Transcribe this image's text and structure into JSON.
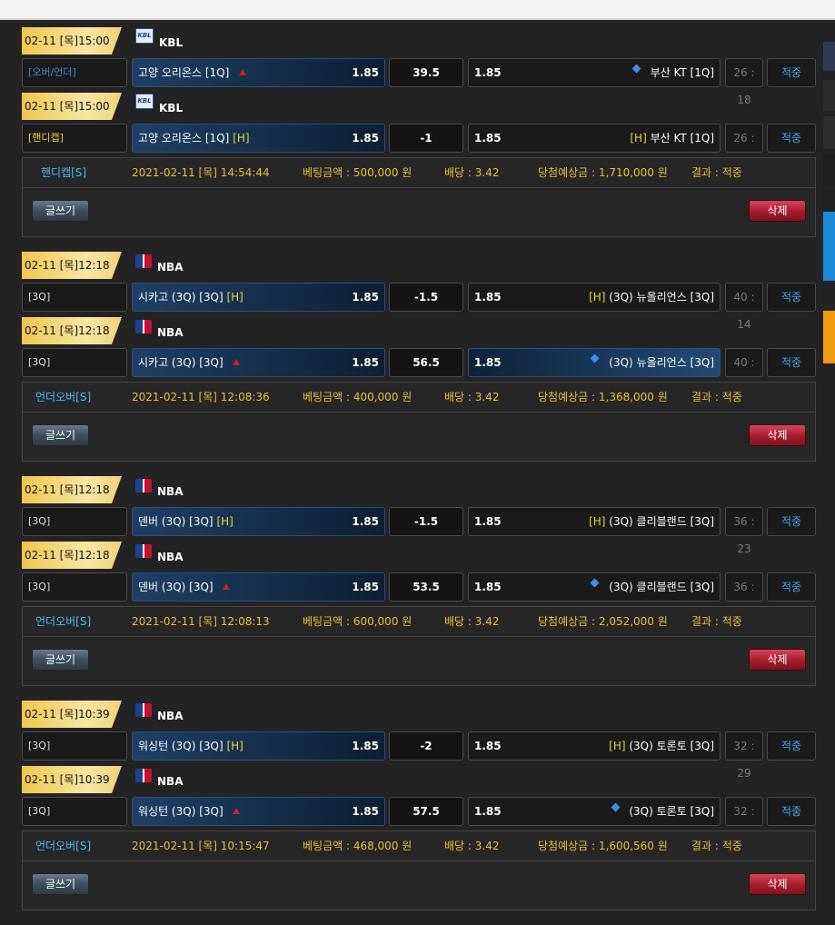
{
  "bets": [
    {
      "matches": [
        {
          "date": "02-11 [목]15:00",
          "league": "KBL",
          "league_icon": "kbl-logo-icon",
          "type": "[오버/언더]",
          "type_color": "#4a7fe5",
          "home": "고양 오리온스 [1Q]",
          "home_mark": "arrow-up",
          "home_h": "",
          "home_odds": "1.85",
          "line": "39.5",
          "away_odds": "1.85",
          "away": "부산 KT [1Q]",
          "away_mark": "diamond",
          "away_h": "",
          "away_selected": false,
          "time": "26 : 18",
          "result": "적중"
        },
        {
          "date": "02-11 [목]15:00",
          "league": "KBL",
          "league_icon": "kbl-logo-icon",
          "type": "[핸디캡]",
          "type_color": "#e9d63c",
          "home": "고양 오리온스 [1Q]",
          "home_mark": "",
          "home_h": "[H]",
          "home_odds": "1.85",
          "line": "-1",
          "away_odds": "1.85",
          "away": "부산 KT [1Q]",
          "away_mark": "",
          "away_h": "[H]",
          "away_selected": false,
          "time": "26 : 18",
          "result": "적중"
        }
      ],
      "summary": {
        "type": "핸디캡[S]",
        "date": "2021-02-11 [목] 14:54:44",
        "amount": "베팅금액 : 500,000 원",
        "odds": "배당 : 3.42",
        "expected": "당첨예상금 : 1,710,000 원",
        "result": "결과 : 적중"
      }
    },
    {
      "matches": [
        {
          "date": "02-11 [목]12:18",
          "league": "NBA",
          "league_icon": "nba-logo-icon",
          "type": "[3Q]",
          "type_color": "#dddddd",
          "home": "시카고 (3Q) [3Q]",
          "home_mark": "",
          "home_h": "[H]",
          "home_odds": "1.85",
          "line": "-1.5",
          "away_odds": "1.85",
          "away": "(3Q) 뉴올리언스 [3Q]",
          "away_mark": "",
          "away_h": "[H]",
          "away_selected": false,
          "time": "40 : 14",
          "result": "적중"
        },
        {
          "date": "02-11 [목]12:18",
          "league": "NBA",
          "league_icon": "nba-logo-icon",
          "type": "[3Q]",
          "type_color": "#dddddd",
          "home": "시카고 (3Q) [3Q]",
          "home_mark": "arrow-up",
          "home_h": "",
          "home_odds": "1.85",
          "line": "56.5",
          "away_odds": "1.85",
          "away": "(3Q) 뉴올리언스 [3Q]",
          "away_mark": "diamond",
          "away_h": "",
          "away_selected": true,
          "time": "40 : 14",
          "result": "적중"
        }
      ],
      "summary": {
        "type": "언더오버[S]",
        "date": "2021-02-11 [목] 12:08:36",
        "amount": "베팅금액 : 400,000 원",
        "odds": "배당 : 3.42",
        "expected": "당첨예상금 : 1,368,000 원",
        "result": "결과 : 적중"
      }
    },
    {
      "matches": [
        {
          "date": "02-11 [목]12:18",
          "league": "NBA",
          "league_icon": "nba-logo-icon",
          "type": "[3Q]",
          "type_color": "#dddddd",
          "home": "덴버 (3Q) [3Q]",
          "home_mark": "",
          "home_h": "[H]",
          "home_odds": "1.85",
          "line": "-1.5",
          "away_odds": "1.85",
          "away": "(3Q) 클리블랜드 [3Q]",
          "away_mark": "",
          "away_h": "[H]",
          "away_selected": false,
          "time": "36 : 23",
          "result": "적중"
        },
        {
          "date": "02-11 [목]12:18",
          "league": "NBA",
          "league_icon": "nba-logo-icon",
          "type": "[3Q]",
          "type_color": "#dddddd",
          "home": "덴버 (3Q) [3Q]",
          "home_mark": "arrow-up",
          "home_h": "",
          "home_odds": "1.85",
          "line": "53.5",
          "away_odds": "1.85",
          "away": "(3Q) 클리블랜드 [3Q]",
          "away_mark": "diamond",
          "away_h": "",
          "away_selected": false,
          "time": "36 : 23",
          "result": "적중"
        }
      ],
      "summary": {
        "type": "언더오버[S]",
        "date": "2021-02-11 [목] 12:08:13",
        "amount": "베팅금액 : 600,000 원",
        "odds": "배당 : 3.42",
        "expected": "당첨예상금 : 2,052,000 원",
        "result": "결과 : 적중"
      }
    },
    {
      "matches": [
        {
          "date": "02-11 [목]10:39",
          "league": "NBA",
          "league_icon": "nba-logo-icon",
          "type": "[3Q]",
          "type_color": "#dddddd",
          "home": "워싱턴 (3Q) [3Q]",
          "home_mark": "",
          "home_h": "[H]",
          "home_odds": "1.85",
          "line": "-2",
          "away_odds": "1.85",
          "away": "(3Q) 토론토 [3Q]",
          "away_mark": "",
          "away_h": "[H]",
          "away_selected": false,
          "time": "32 : 29",
          "result": "적중"
        },
        {
          "date": "02-11 [목]10:39",
          "league": "NBA",
          "league_icon": "nba-logo-icon",
          "type": "[3Q]",
          "type_color": "#dddddd",
          "home": "워싱턴 (3Q) [3Q]",
          "home_mark": "arrow-up",
          "home_h": "",
          "home_odds": "1.85",
          "line": "57.5",
          "away_odds": "1.85",
          "away": "(3Q) 토론토 [3Q]",
          "away_mark": "diamond",
          "away_h": "",
          "away_selected": false,
          "time": "32 : 29",
          "result": "적중"
        }
      ],
      "summary": {
        "type": "언더오버[S]",
        "date": "2021-02-11 [목] 10:15:47",
        "amount": "베팅금액 : 468,000 원",
        "odds": "배당 : 3.42",
        "expected": "당첨예상금 : 1,600,560 원",
        "result": "결과 : 적중"
      }
    }
  ],
  "buttons": {
    "write": "글쓰기",
    "delete": "삭제"
  },
  "colors": {
    "accent_blue": "#47a3f1",
    "gold": "#e2c23c",
    "delete_red": "#a51c2d"
  }
}
